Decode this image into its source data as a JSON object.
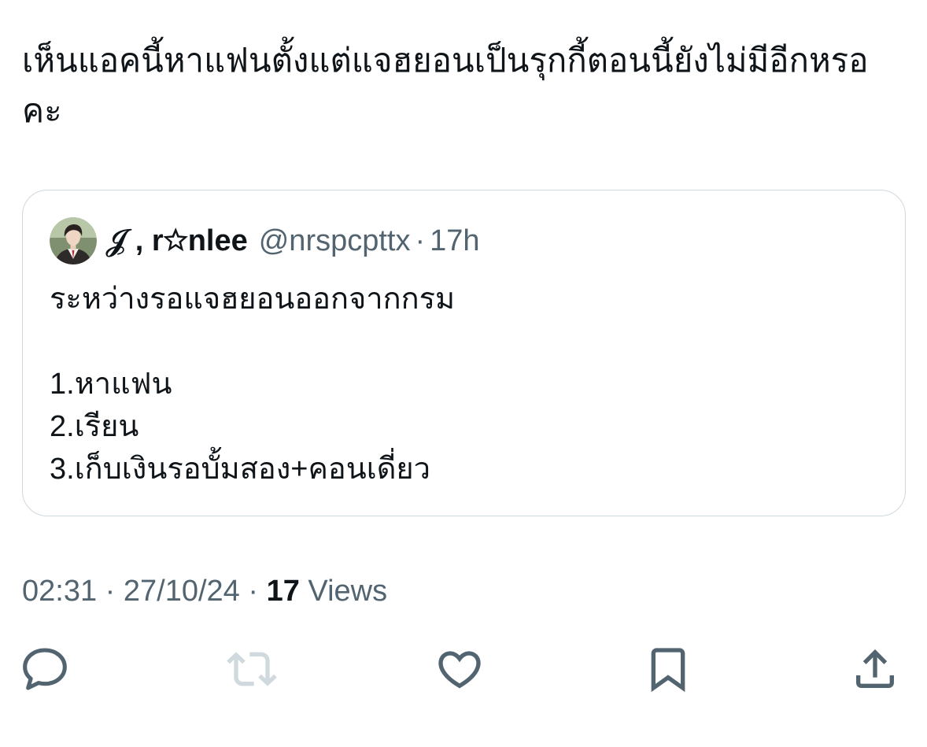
{
  "tweet": {
    "text": "เห็นแอคนี้หาแฟนตั้งแต่แจฮยอนเป็นรุกกี้ตอนนี้ยังไม่มีอีกหรอคะ",
    "quoted_tweet": {
      "author": {
        "display_name": "𝒥 , r☆nlee",
        "handle": "@nrspcpttx"
      },
      "separator": "·",
      "time_ago": "17h",
      "body": {
        "intro": "ระหว่างรอแจฮยอนออกจากกรม",
        "items": [
          "1.หาแฟน",
          "2.เรียน",
          "3.เก็บเงินรอบั้มสอง+คอนเดี่ยว"
        ]
      }
    },
    "meta": {
      "time": "02:31",
      "separator": "·",
      "date": "27/10/24",
      "views_count": "17",
      "views_label": "Views"
    }
  },
  "actions": [
    {
      "icon": "reply-icon",
      "enabled": true
    },
    {
      "icon": "retweet-icon",
      "enabled": false
    },
    {
      "icon": "heart-icon",
      "enabled": true
    },
    {
      "icon": "bookmark-icon",
      "enabled": true
    },
    {
      "icon": "share-icon",
      "enabled": true
    }
  ],
  "colors": {
    "background": "#ffffff",
    "text": "#0f1419",
    "secondary_text": "#536471",
    "border": "#cfd9de",
    "icon": "#536471",
    "icon_disabled": "#cfd9de"
  }
}
